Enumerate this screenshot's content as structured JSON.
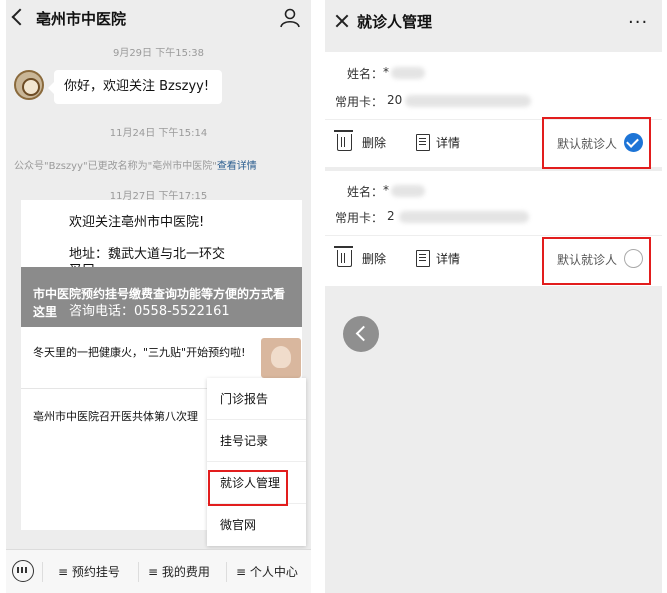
{
  "left": {
    "title": "亳州市中医院",
    "timestamps": [
      "9月29日 下午15:38",
      "11月24日 下午15:14",
      "11月27日 下午17:15"
    ],
    "greeting": "你好，欢迎关注 Bzszyy!",
    "system_note": "公众号\"Bzszyy\"已更改名称为\"亳州市中医院\"",
    "system_note_link": "查看详情",
    "welcome_lines": [
      "欢迎关注亳州市中医院!",
      "地址：魏武大道与北一环交",
      "叉口"
    ],
    "banner_text": "市中医院预约挂号缴费查询功能等方便的方式看这里",
    "consult_phone": "咨询电话：0558-5522161",
    "articles": [
      "冬天里的一把健康火，\"三九贴\"开始预约啦!",
      "亳州市中医院召开医共体第八次理"
    ],
    "menu_items": [
      "门诊报告",
      "挂号记录",
      "就诊人管理",
      "微官网"
    ],
    "tabs": [
      "≡ 预约挂号",
      "≡ 我的费用",
      "≡ 个人中心"
    ]
  },
  "right": {
    "title": "就诊人管理",
    "more": "···",
    "patients": [
      {
        "name_label": "姓名：",
        "name_value": "*",
        "card_label": "常用卡：",
        "card_value": "20",
        "delete_label": "删除",
        "detail_label": "详情",
        "default_label": "默认就诊人",
        "is_default": true
      },
      {
        "name_label": "姓名：",
        "name_value": "*",
        "card_label": "常用卡：",
        "card_value": "2",
        "delete_label": "删除",
        "detail_label": "详情",
        "default_label": "默认就诊人",
        "is_default": false
      }
    ]
  },
  "colors": {
    "accent": "#1d74d6",
    "highlight_box": "#e21d1d",
    "background": "#ededed"
  }
}
